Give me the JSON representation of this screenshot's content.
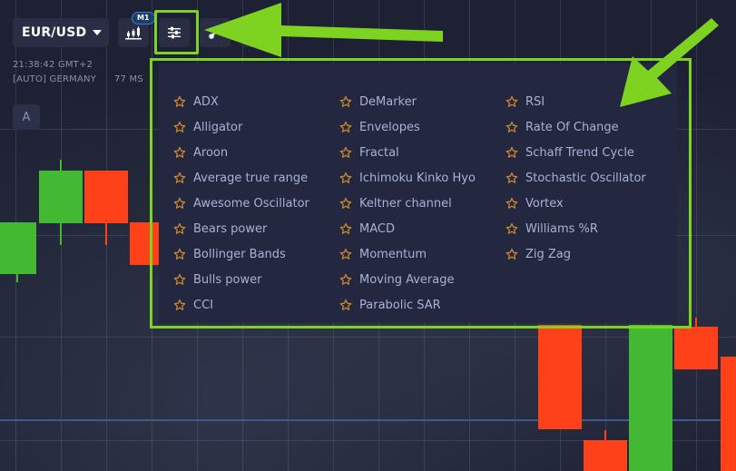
{
  "toolbar": {
    "pair_label": "EUR/USD",
    "timeframe_badge": "M1",
    "buttons": [
      {
        "name": "chart-type-button",
        "icon": "candlestick-icon"
      },
      {
        "name": "indicators-button",
        "icon": "sliders-icon",
        "highlighted": true
      },
      {
        "name": "drawing-tools-button",
        "icon": "pencil-line-icon"
      }
    ]
  },
  "info": {
    "time": "21:38:42 GMT+2",
    "server": "[AUTO] GERMANY",
    "ping": "77 MS"
  },
  "auto_button_label": "A",
  "indicators_menu": {
    "columns": [
      [
        "ADX",
        "Alligator",
        "Aroon",
        "Average true range",
        "Awesome Oscillator",
        "Bears power",
        "Bollinger Bands",
        "Bulls power",
        "CCI"
      ],
      [
        "DeMarker",
        "Envelopes",
        "Fractal",
        "Ichimoku Kinko Hyo",
        "Keltner channel",
        "MACD",
        "Momentum",
        "Moving Average",
        "Parabolic SAR"
      ],
      [
        "RSI",
        "Rate Of Change",
        "Schaff Trend Cycle",
        "Stochastic Oscillator",
        "Vortex",
        "Williams %R",
        "Zig Zag"
      ]
    ],
    "item_icon": "star-outline-icon"
  },
  "colors": {
    "background": "#1e2133",
    "panel": "#232840",
    "up_candle": "#43b833",
    "down_candle": "#ff4119",
    "annotation": "#7ed321",
    "star": "#c8862f",
    "price_line": "#3f5a86"
  }
}
